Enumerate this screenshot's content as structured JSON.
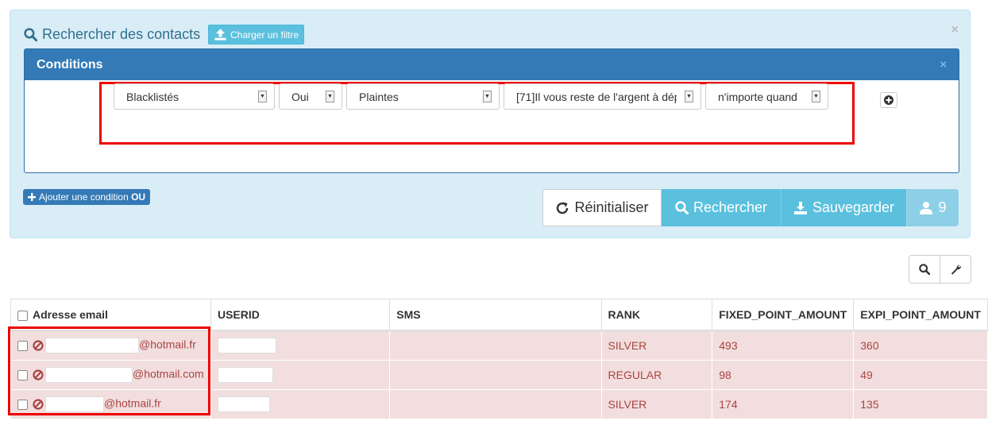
{
  "search_panel": {
    "title": "Rechercher des contacts",
    "load_filter_label": "Charger un filtre",
    "close": "×"
  },
  "conditions": {
    "title": "Conditions",
    "close": "×",
    "selects": [
      {
        "value": "Blacklistés"
      },
      {
        "value": "Oui"
      },
      {
        "value": "Plaintes"
      },
      {
        "value": "[71]Il vous reste de l'argent à dép"
      },
      {
        "value": "n'importe quand"
      }
    ]
  },
  "add_or": {
    "label": "Ajouter une condition ",
    "bold": "OU"
  },
  "actions": {
    "reset": "Réinitialiser",
    "search": "Rechercher",
    "save": "Sauvegarder",
    "count": "9"
  },
  "table": {
    "columns": [
      "Adresse email",
      "USERID",
      "SMS",
      "RANK",
      "FIXED_POINT_AMOUNT",
      "EXPI_POINT_AMOUNT"
    ],
    "rows": [
      {
        "email_suffix": "@hotmail.fr",
        "rank": "SILVER",
        "fixed": "493",
        "expi": "360"
      },
      {
        "email_suffix": "@hotmail.com",
        "rank": "REGULAR",
        "fixed": "98",
        "expi": "49"
      },
      {
        "email_suffix": "@hotmail.fr",
        "rank": "SILVER",
        "fixed": "174",
        "expi": "135"
      }
    ]
  },
  "colors": {
    "accent": "#337ab7",
    "info": "#5bc0de",
    "danger_row": "#f2dede",
    "highlight": "#ee0000"
  }
}
